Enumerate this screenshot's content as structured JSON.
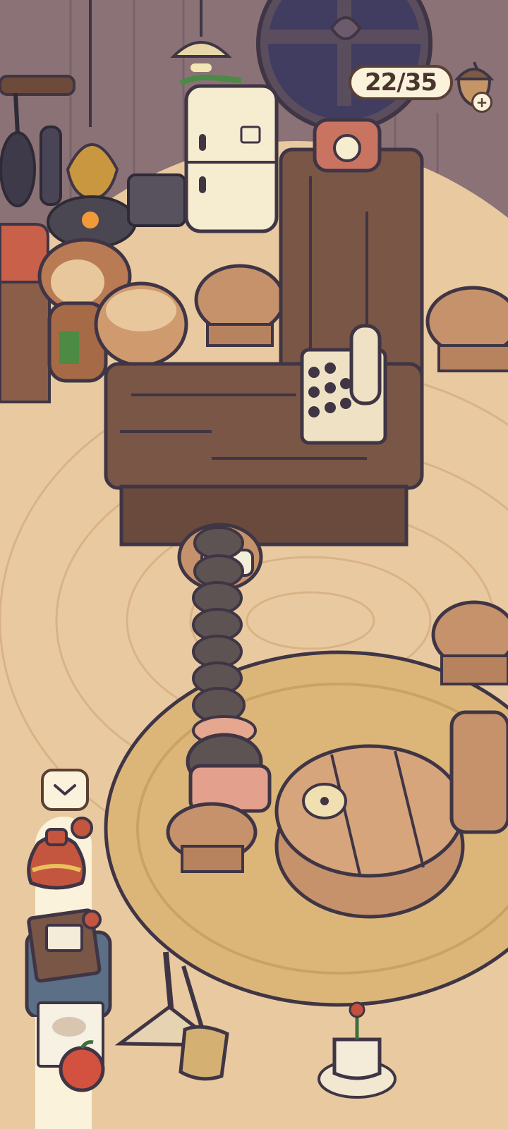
{
  "hud": {
    "acorn_counter": "22/35",
    "acorn_icon": "acorn-icon",
    "add_icon": "plus-icon",
    "add_label": "+"
  },
  "side_tray": {
    "collapse_icon": "chevron-down-icon",
    "items": [
      {
        "name": "lucky-pouch-item"
      },
      {
        "name": "stationery-stack-item"
      },
      {
        "name": "papers-and-apple-item"
      }
    ]
  },
  "colors": {
    "outline": "#5a3f33",
    "floor": "#e9caa0",
    "rug": "#dcb679",
    "counter_wood": "#7a5646",
    "panel": "#fbf2dc"
  }
}
